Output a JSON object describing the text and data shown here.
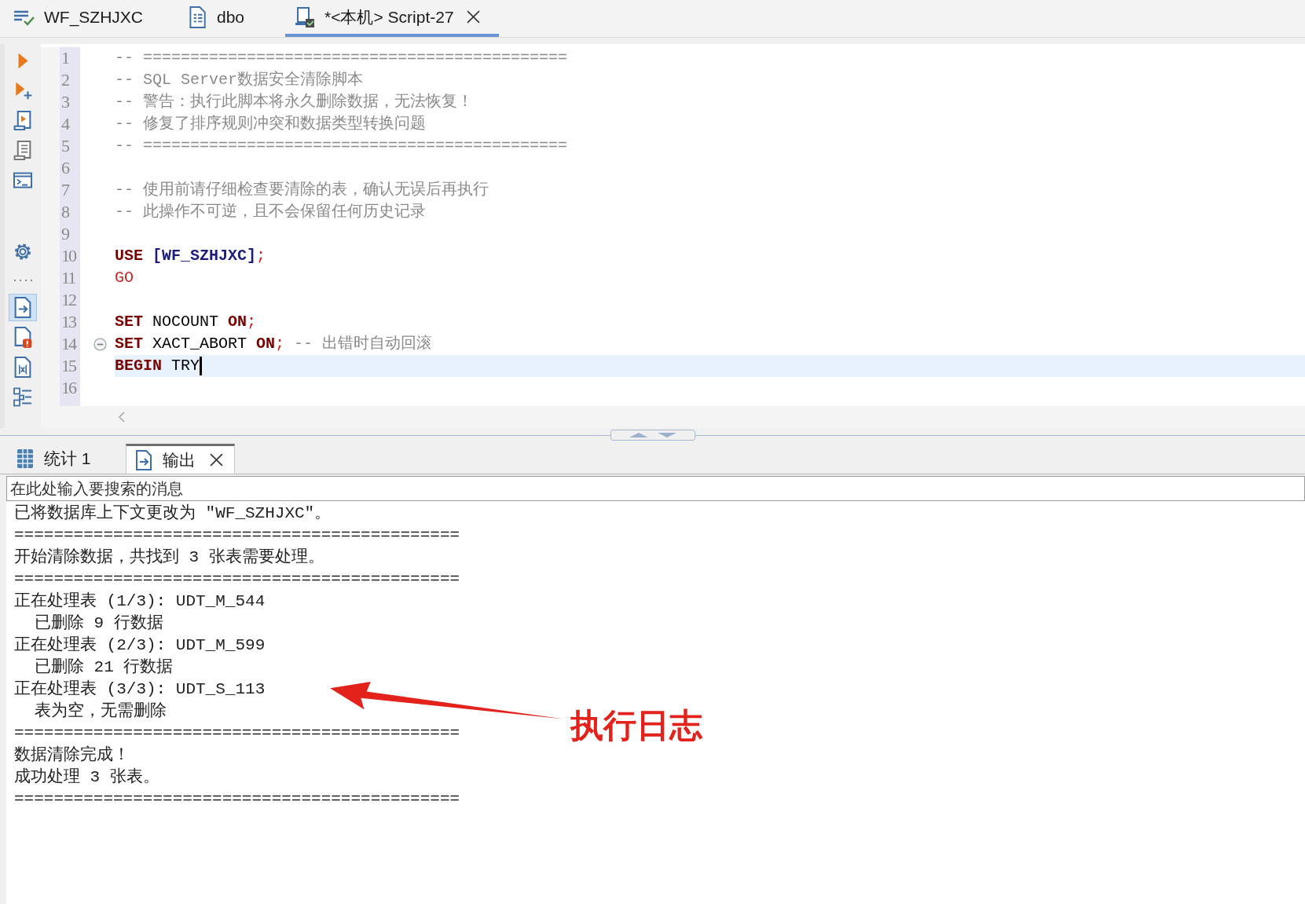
{
  "editor_tabs": [
    {
      "label": "WF_SZHJXC",
      "kind": "database",
      "selected": false,
      "closable": false
    },
    {
      "label": "dbo",
      "kind": "schema",
      "selected": false,
      "closable": false
    },
    {
      "label": "*<本机> Script-27",
      "kind": "script",
      "selected": true,
      "closable": true
    }
  ],
  "toolbar": {
    "top": [
      {
        "kind": "run",
        "selected": false
      },
      {
        "kind": "run-new",
        "selected": false
      },
      {
        "kind": "script-run",
        "selected": false
      },
      {
        "kind": "plan",
        "selected": false
      },
      {
        "kind": "terminal",
        "selected": false
      }
    ],
    "settings": {
      "kind": "settings",
      "selected": false
    },
    "panels": [
      {
        "kind": "output",
        "selected": true
      },
      {
        "kind": "problems",
        "selected": false
      },
      {
        "kind": "variables",
        "selected": false
      },
      {
        "kind": "outline",
        "selected": false
      }
    ]
  },
  "editor": {
    "lines": [
      {
        "number": "1",
        "current": false,
        "fold": false,
        "tokens": [
          {
            "kind": "comment",
            "text": "-- ============================================="
          }
        ]
      },
      {
        "number": "2",
        "current": false,
        "fold": false,
        "tokens": [
          {
            "kind": "comment",
            "text": "-- SQL Server数据安全清除脚本"
          }
        ]
      },
      {
        "number": "3",
        "current": false,
        "fold": false,
        "tokens": [
          {
            "kind": "comment",
            "text": "-- 警告：执行此脚本将永久删除数据，无法恢复！"
          }
        ]
      },
      {
        "number": "4",
        "current": false,
        "fold": false,
        "tokens": [
          {
            "kind": "comment",
            "text": "-- 修复了排序规则冲突和数据类型转换问题"
          }
        ]
      },
      {
        "number": "5",
        "current": false,
        "fold": false,
        "tokens": [
          {
            "kind": "comment",
            "text": "-- ============================================="
          }
        ]
      },
      {
        "number": "6",
        "current": false,
        "fold": false
      },
      {
        "number": "7",
        "current": false,
        "fold": false,
        "tokens": [
          {
            "kind": "comment",
            "text": "-- 使用前请仔细检查要清除的表，确认无误后再执行"
          }
        ]
      },
      {
        "number": "8",
        "current": false,
        "fold": false,
        "tokens": [
          {
            "kind": "comment",
            "text": "-- 此操作不可逆，且不会保留任何历史记录"
          }
        ]
      },
      {
        "number": "9",
        "current": false,
        "fold": false
      },
      {
        "number": "10",
        "current": false,
        "fold": false,
        "tokens": [
          {
            "kind": "keyword",
            "text": "USE"
          },
          {
            "kind": "object",
            "text": " [WF_SZHJXC]"
          },
          {
            "kind": "punct",
            "text": ";"
          }
        ]
      },
      {
        "number": "11",
        "current": false,
        "fold": false,
        "tokens": [
          {
            "kind": "batch",
            "text": "GO"
          }
        ]
      },
      {
        "number": "12",
        "current": false,
        "fold": false
      },
      {
        "number": "13",
        "current": false,
        "fold": false,
        "tokens": [
          {
            "kind": "keyword",
            "text": "SET"
          },
          {
            "kind": "plain",
            "text": " NOCOUNT "
          },
          {
            "kind": "keyword",
            "text": "ON"
          },
          {
            "kind": "punct",
            "text": ";"
          }
        ]
      },
      {
        "number": "14",
        "current": false,
        "fold": true,
        "tokens": [
          {
            "kind": "keyword",
            "text": "SET"
          },
          {
            "kind": "plain",
            "text": " XACT_ABORT "
          },
          {
            "kind": "keyword",
            "text": "ON"
          },
          {
            "kind": "punct",
            "text": ";"
          },
          {
            "kind": "comment",
            "text": " -- 出错时自动回滚"
          }
        ]
      },
      {
        "number": "15",
        "current": true,
        "fold": false,
        "tokens": [
          {
            "kind": "keyword",
            "text": "BEGIN"
          },
          {
            "kind": "plain",
            "text": " TRY"
          }
        ]
      },
      {
        "number": "16",
        "current": false,
        "fold": false
      }
    ]
  },
  "result_tabs": [
    {
      "label": "统计 1",
      "kind": "grid",
      "selected": false,
      "closable": false
    },
    {
      "label": "输出",
      "kind": "output",
      "selected": true,
      "closable": true
    }
  ],
  "search": {
    "placeholder": "在此处输入要搜索的消息"
  },
  "output": {
    "lines": [
      {
        "kind": "plain",
        "text": "已将数据库上下文更改为 \"WF_SZHJXC\"。"
      },
      {
        "kind": "plain",
        "text": "============================================="
      },
      {
        "kind": "plain",
        "text": "开始清除数据，共找到 3 张表需要处理。"
      },
      {
        "kind": "plain",
        "text": "============================================="
      },
      {
        "kind": "plain",
        "text": "正在处理表 (1/3): UDT_M_544"
      },
      {
        "kind": "detail",
        "text": "已删除 9 行数据"
      },
      {
        "kind": "plain",
        "text": "正在处理表 (2/3): UDT_M_599"
      },
      {
        "kind": "detail",
        "text": "已删除 21 行数据"
      },
      {
        "kind": "plain",
        "text": "正在处理表 (3/3): UDT_S_113"
      },
      {
        "kind": "detail",
        "text": "表为空，无需删除"
      },
      {
        "kind": "plain",
        "text": "============================================="
      },
      {
        "kind": "plain",
        "text": "数据清除完成！"
      },
      {
        "kind": "plain",
        "text": "成功处理 3 张表。"
      },
      {
        "kind": "plain",
        "text": "============================================="
      }
    ]
  },
  "annotation": {
    "text": "执行日志"
  }
}
